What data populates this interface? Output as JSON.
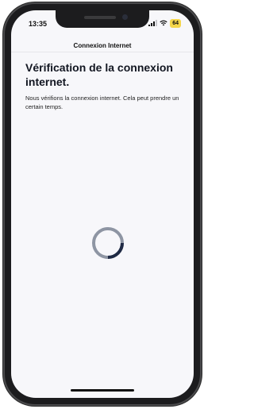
{
  "status_bar": {
    "time": "13:35",
    "battery_level": "64",
    "battery_color": "#f5d64a",
    "icons": [
      "signal-icon",
      "wifi-icon",
      "battery-icon"
    ]
  },
  "nav": {
    "title": "Connexion Internet"
  },
  "main": {
    "heading": "Vérification de la connexion internet.",
    "description": "Nous vérifions la connexion internet. Cela peut prendre un certain temps."
  },
  "loading": {
    "icon": "loading-spinner-icon",
    "track_color": "#8e95a3",
    "arc_color": "#1f2a44"
  }
}
